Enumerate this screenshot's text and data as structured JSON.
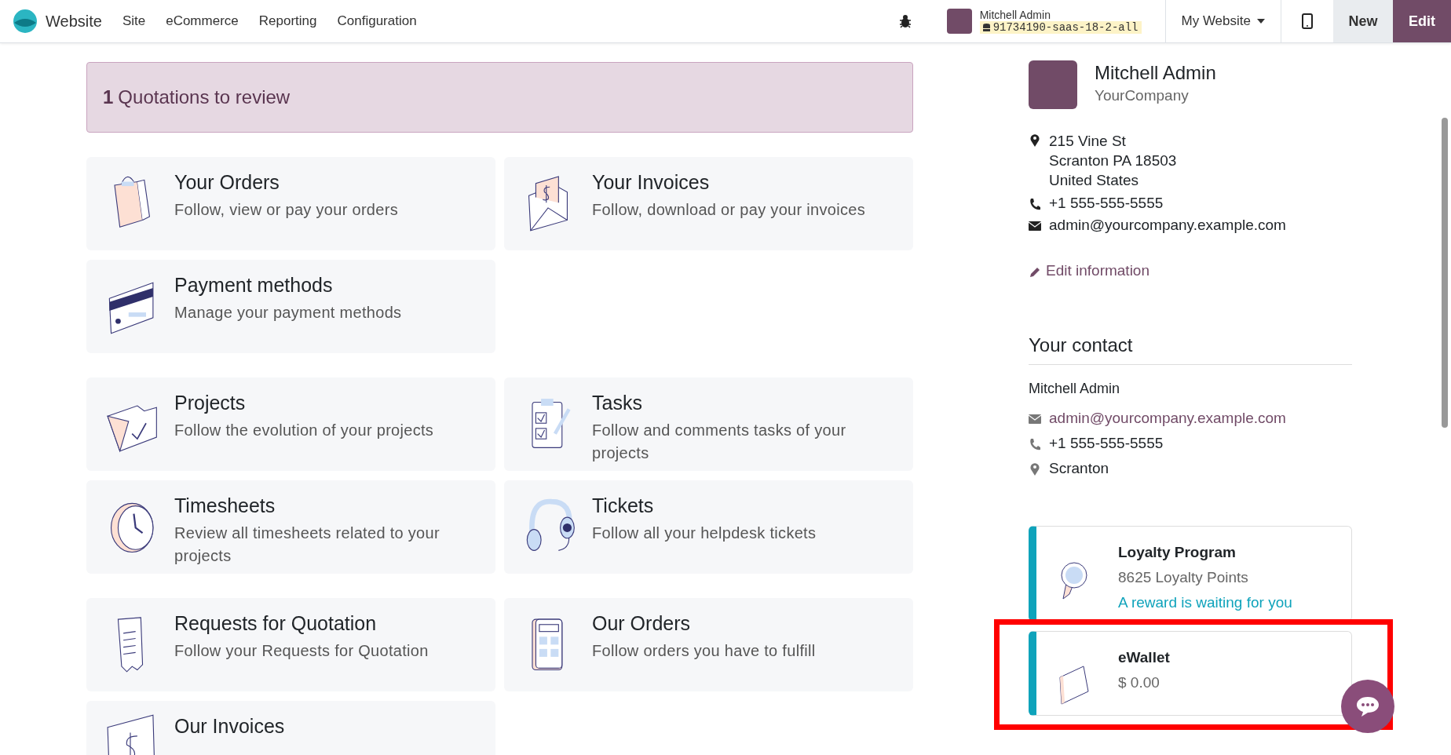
{
  "navbar": {
    "brand": "Website",
    "menu": [
      "Site",
      "eCommerce",
      "Reporting",
      "Configuration"
    ],
    "user_name": "Mitchell Admin",
    "database": "91734190-saas-18-2-all",
    "website_switcher": "My Website",
    "new_button": "New",
    "edit_button": "Edit"
  },
  "alert": {
    "count": "1",
    "text": "Quotations to review"
  },
  "sections": [
    {
      "cards": [
        {
          "title": "Your Orders",
          "subtitle": "Follow, view or pay your orders"
        },
        {
          "title": "Your Invoices",
          "subtitle": "Follow, download or pay your invoices"
        },
        {
          "title": "Payment methods",
          "subtitle": "Manage your payment methods"
        }
      ]
    },
    {
      "cards": [
        {
          "title": "Projects",
          "subtitle": "Follow the evolution of your projects"
        },
        {
          "title": "Tasks",
          "subtitle": "Follow and comments tasks of your projects"
        },
        {
          "title": "Timesheets",
          "subtitle": "Review all timesheets related to your projects"
        },
        {
          "title": "Tickets",
          "subtitle": "Follow all your helpdesk tickets"
        }
      ]
    },
    {
      "cards": [
        {
          "title": "Requests for Quotation",
          "subtitle": "Follow your Requests for Quotation"
        },
        {
          "title": "Our Orders",
          "subtitle": "Follow orders you have to fulfill"
        },
        {
          "title": "Our Invoices"
        }
      ]
    }
  ],
  "profile": {
    "name": "Mitchell Admin",
    "company": "YourCompany",
    "address": [
      "215 Vine St",
      "Scranton PA 18503",
      "United States"
    ],
    "phone": "+1 555-555-5555",
    "email": "admin@yourcompany.example.com",
    "edit_link": "Edit information"
  },
  "contact": {
    "heading": "Your contact",
    "name": "Mitchell Admin",
    "email": "admin@yourcompany.example.com",
    "phone": "+1 555-555-5555",
    "city": "Scranton"
  },
  "programs": [
    {
      "kind": "loyalty",
      "title": "Loyalty Program",
      "value": "8625 Loyalty Points",
      "link": "A reward is waiting for you",
      "highlighted": false
    },
    {
      "kind": "ewallet",
      "title": "eWallet",
      "value": "$ 0.00",
      "highlighted": true
    }
  ]
}
